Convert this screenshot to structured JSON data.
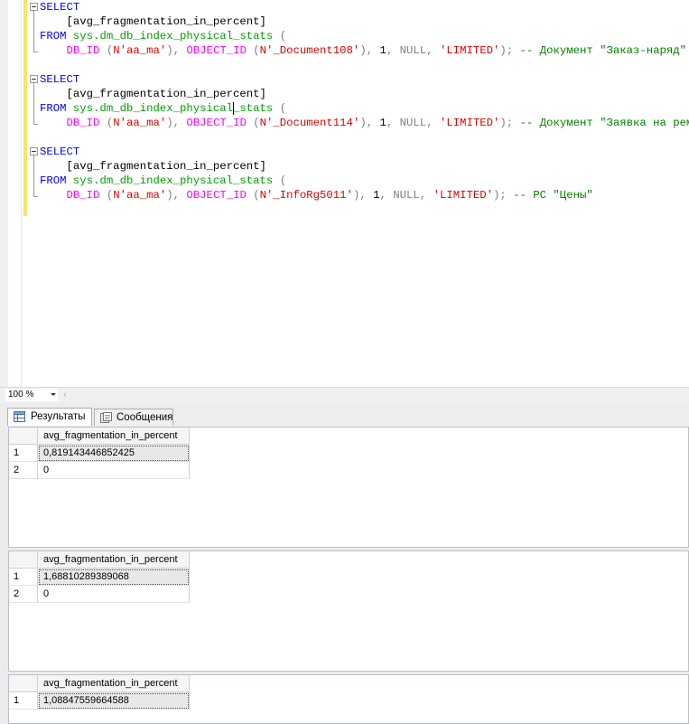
{
  "editor": {
    "queries": [
      {
        "select": "SELECT",
        "column": "[avg_fragmentation_in_percent]",
        "from": "FROM",
        "func": "sys.dm_db_index_physical_stats",
        "open_paren": " (",
        "db_fn": "DB_ID",
        "db_arg": "N'aa_ma'",
        "obj_fn": "OBJECT_ID",
        "obj_arg": "N'_Document108'",
        "arg_one": "1",
        "arg_null": "NULL",
        "arg_mode": "'LIMITED'",
        "comment": "-- Документ \"Заказ-наряд\""
      },
      {
        "select": "SELECT",
        "column": "[avg_fragmentation_in_percent]",
        "from": "FROM",
        "func_a": "sys.dm_db_index_physical",
        "func_b": "_stats",
        "open_paren": " (",
        "db_fn": "DB_ID",
        "db_arg": "N'aa_ma'",
        "obj_fn": "OBJECT_ID",
        "obj_arg": "N'_Document114'",
        "arg_one": "1",
        "arg_null": "NULL",
        "arg_mode": "'LIMITED'",
        "comment": "-- Документ \"Заявка на ремонт\""
      },
      {
        "select": "SELECT",
        "column": "[avg_fragmentation_in_percent]",
        "from": "FROM",
        "func": "sys.dm_db_index_physical_stats",
        "open_paren": " (",
        "db_fn": "DB_ID",
        "db_arg": "N'aa_ma'",
        "obj_fn": "OBJECT_ID",
        "obj_arg": "N'_InfoRg5011'",
        "arg_one": "1",
        "arg_null": "NULL",
        "arg_mode": "'LIMITED'",
        "comment": "-- РС \"Цены\""
      }
    ]
  },
  "zoom": {
    "value": "100 %"
  },
  "tabs": {
    "results": "Результаты",
    "messages": "Сообщения"
  },
  "results": [
    {
      "header": "avg_fragmentation_in_percent",
      "rows": [
        {
          "num": "1",
          "value": "0,819143446852425"
        },
        {
          "num": "2",
          "value": "0"
        }
      ]
    },
    {
      "header": "avg_fragmentation_in_percent",
      "rows": [
        {
          "num": "1",
          "value": "1,68810289389068"
        },
        {
          "num": "2",
          "value": "0"
        }
      ]
    },
    {
      "header": "avg_fragmentation_in_percent",
      "rows": [
        {
          "num": "1",
          "value": "1,08847559664588"
        }
      ]
    }
  ],
  "colors": {
    "keyword": "#0000ff",
    "system_object": "#00a000",
    "function": "#ff00ff",
    "string": "#e00000",
    "comment": "#008000",
    "change_bar": "#f5e56b"
  }
}
